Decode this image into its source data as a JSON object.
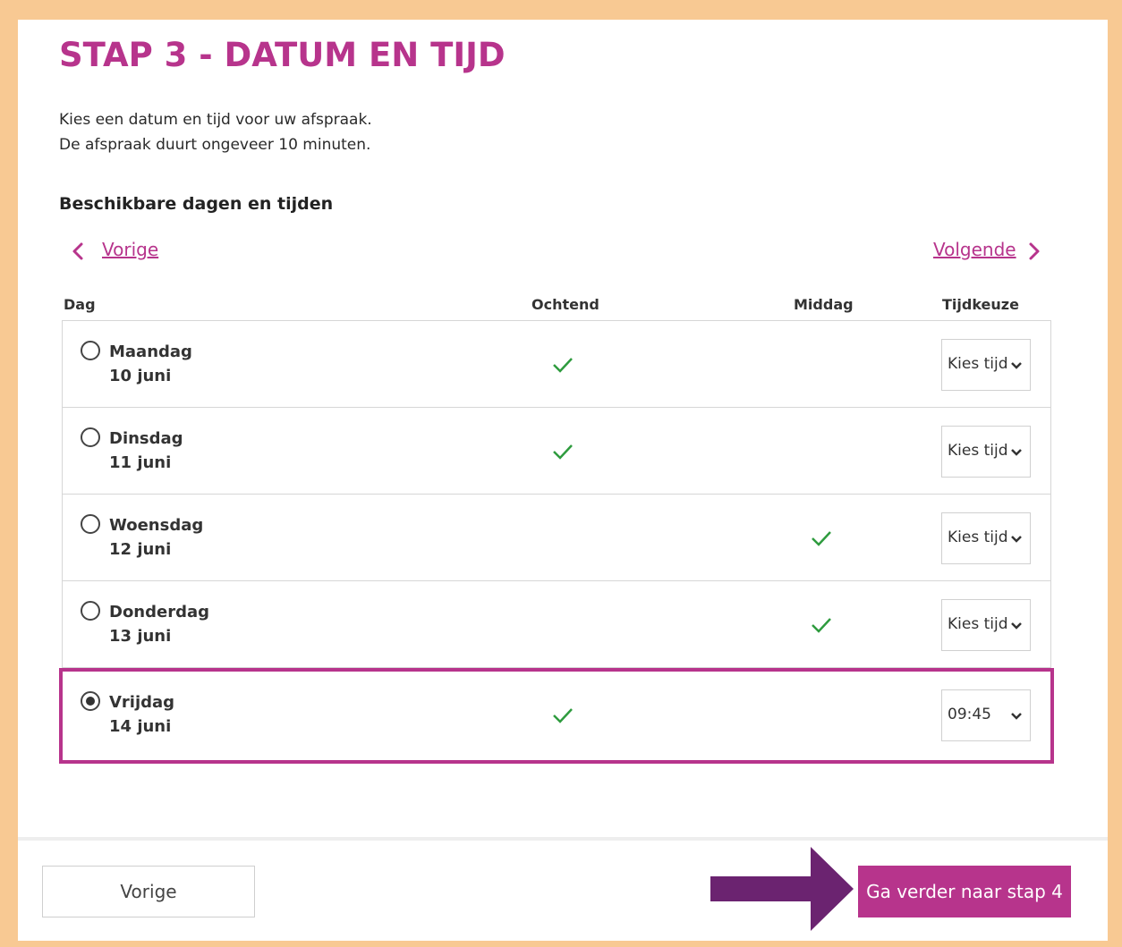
{
  "title": "STAP 3 - DATUM EN TIJD",
  "intro": [
    "Kies een datum en tijd voor uw afspraak.",
    "De afspraak duurt ongeveer 10 minuten."
  ],
  "section_title": "Beschikbare dagen en tijden",
  "nav": {
    "prev_label": "Vorige",
    "next_label": "Volgende"
  },
  "columns": {
    "day": "Dag",
    "morning": "Ochtend",
    "afternoon": "Middag",
    "time": "Tijdkeuze"
  },
  "rows": [
    {
      "day": "Maandag",
      "date": "10 juni",
      "morning": true,
      "afternoon": false,
      "time": "Kies tijd",
      "selected": false
    },
    {
      "day": "Dinsdag",
      "date": "11 juni",
      "morning": true,
      "afternoon": false,
      "time": "Kies tijd",
      "selected": false
    },
    {
      "day": "Woensdag",
      "date": "12 juni",
      "morning": false,
      "afternoon": true,
      "time": "Kies tijd",
      "selected": false
    },
    {
      "day": "Donderdag",
      "date": "13 juni",
      "morning": false,
      "afternoon": true,
      "time": "Kies tijd",
      "selected": false
    },
    {
      "day": "Vrijdag",
      "date": "14 juni",
      "morning": true,
      "afternoon": false,
      "time": "09:45",
      "selected": true
    }
  ],
  "footer": {
    "prev_button": "Vorige",
    "next_button": "Ga verder naar stap 4"
  },
  "colors": {
    "accent": "#b7348c",
    "check": "#2e9b3e",
    "arrow": "#6b2370",
    "page_border": "#f8c993"
  },
  "icons": {
    "prev": "chevron-left-icon",
    "next": "chevron-right-icon",
    "check": "check-icon",
    "select": "chevron-down-icon",
    "pointer": "arrow-right-icon"
  }
}
